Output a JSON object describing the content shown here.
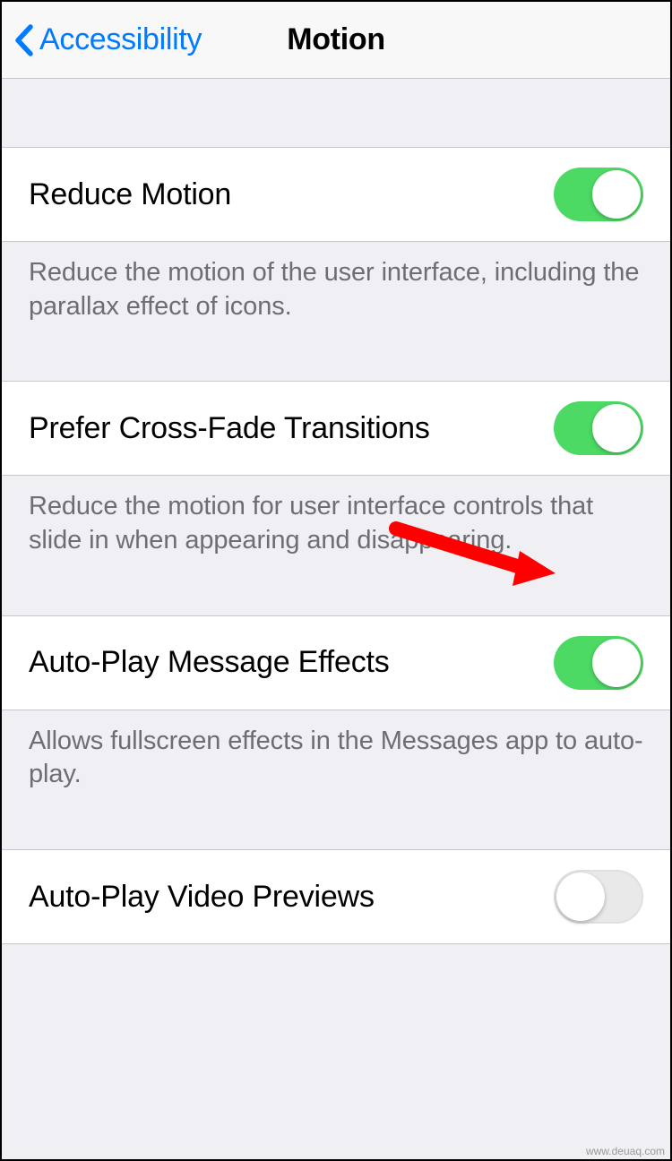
{
  "header": {
    "back_label": "Accessibility",
    "title": "Motion"
  },
  "settings": [
    {
      "label": "Reduce Motion",
      "description": "Reduce the motion of the user interface, including the parallax effect of icons.",
      "enabled": true
    },
    {
      "label": "Prefer Cross-Fade Transitions",
      "description": "Reduce the motion for user interface controls that slide in when appearing and disappearing.",
      "enabled": true
    },
    {
      "label": "Auto-Play Message Effects",
      "description": "Allows fullscreen effects in the Messages app to auto-play.",
      "enabled": true
    },
    {
      "label": "Auto-Play Video Previews",
      "description": "",
      "enabled": false
    }
  ],
  "annotation": {
    "arrow_color": "#ff0000"
  },
  "watermark": "www.deuaq.com"
}
